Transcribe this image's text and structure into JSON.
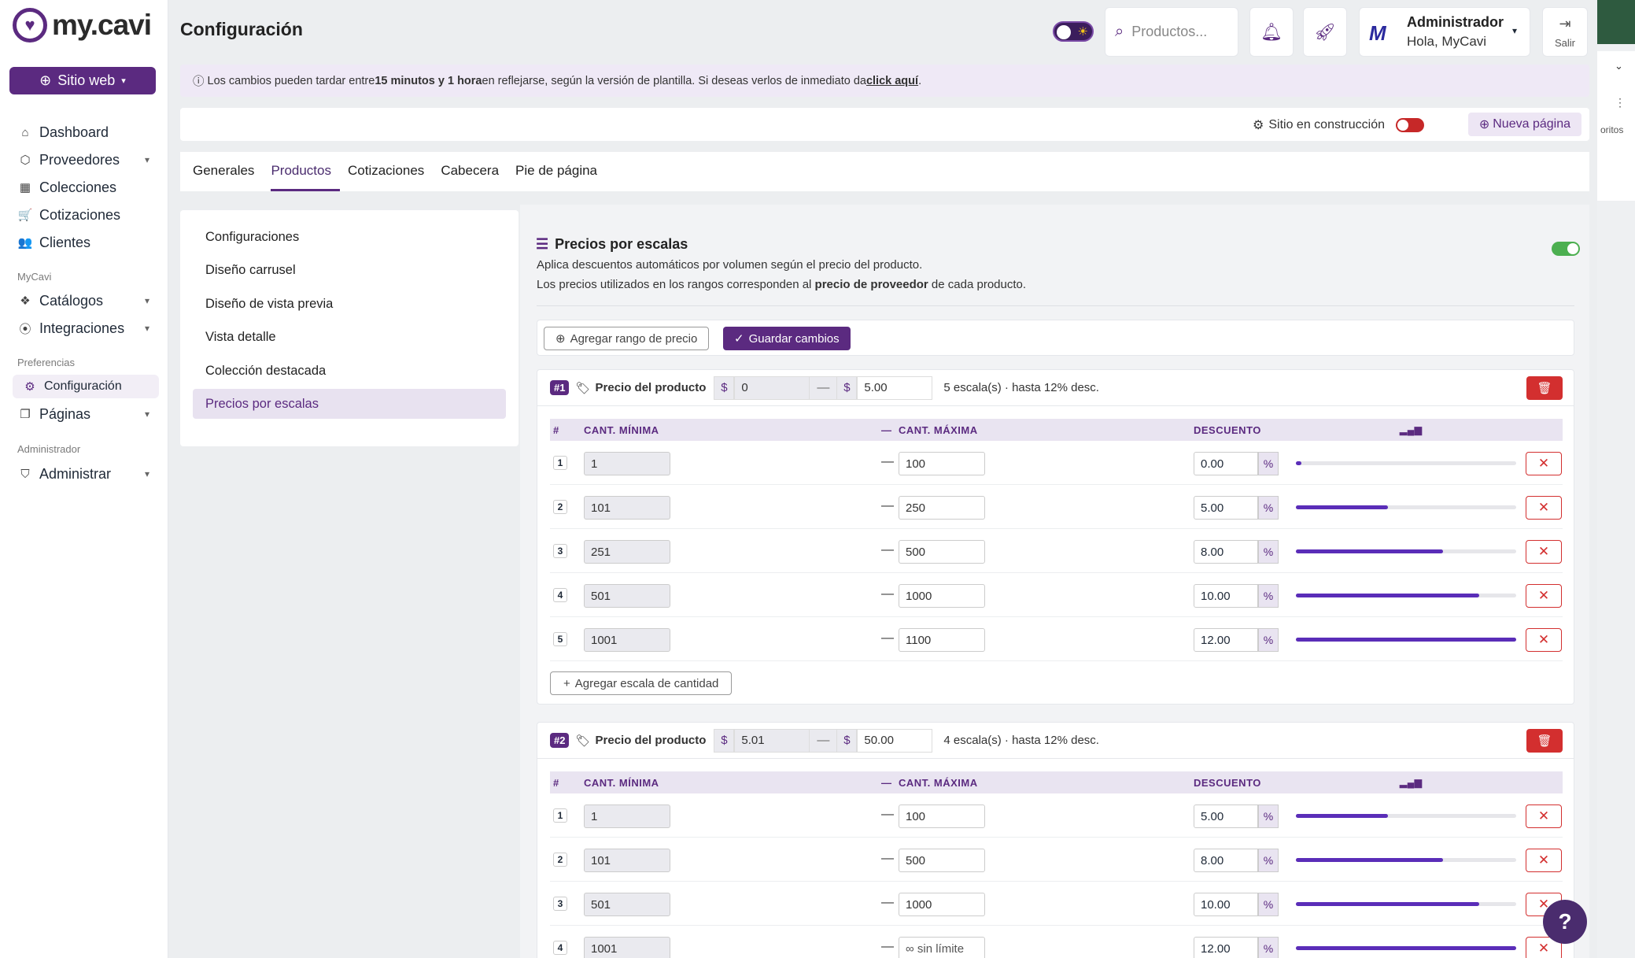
{
  "sidebar": {
    "logo": "my.cavi",
    "site_button": "Sitio web",
    "items": [
      {
        "label": "Dashboard",
        "icon": "home-icon"
      },
      {
        "label": "Proveedores",
        "icon": "box-icon"
      },
      {
        "label": "Colecciones",
        "icon": "grid-icon"
      },
      {
        "label": "Cotizaciones",
        "icon": "cart-icon"
      },
      {
        "label": "Clientes",
        "icon": "users-icon"
      }
    ],
    "sections": {
      "mycavi": "MyCavi",
      "prefs": "Preferencias",
      "admin": "Administrador"
    },
    "mycavi_items": [
      {
        "label": "Catálogos"
      },
      {
        "label": "Integraciones"
      }
    ],
    "prefs_items": [
      {
        "label": "Configuración"
      },
      {
        "label": "Páginas"
      }
    ],
    "admin_items": [
      {
        "label": "Administrar"
      }
    ]
  },
  "header": {
    "title": "Configuración",
    "search_placeholder": "Productos...",
    "user_name": "Administrador",
    "user_greeting": "Hola, MyCavi",
    "logout": "Salir"
  },
  "notice": {
    "pre": "Los cambios pueden tardar entre ",
    "bold": "15 minutos y 1 hora",
    "mid": " en reflejarse, según la versión de plantilla. Si deseas verlos de inmediato da ",
    "link": "click aquí",
    "post": "."
  },
  "toolbar": {
    "construction": "Sitio en construcción",
    "new_page": "Nueva página"
  },
  "tabs": [
    "Generales",
    "Productos",
    "Cotizaciones",
    "Cabecera",
    "Pie de página"
  ],
  "subnav": [
    "Configuraciones",
    "Diseño carrusel",
    "Diseño de vista previa",
    "Vista detalle",
    "Colección destacada",
    "Precios por escalas"
  ],
  "section": {
    "title": "Precios por escalas",
    "desc1": "Aplica descuentos automáticos por volumen según el precio del producto.",
    "desc2_pre": "Los precios utilizados en los rangos corresponden al ",
    "desc2_bold": "precio de proveedor",
    "desc2_post": " de cada producto.",
    "add_range": "Agregar rango de precio",
    "save": "Guardar cambios",
    "enabled": true
  },
  "table_headers": {
    "num": "#",
    "min": "CANT. MÍNIMA",
    "max": "CANT. MÁXIMA",
    "disc": "DESCUENTO",
    "dash": "—"
  },
  "add_scale": "Agregar escala de cantidad",
  "ranges": [
    {
      "badge": "#1",
      "label": "Precio del producto",
      "currency": "$",
      "from": "0",
      "to": "5.00",
      "summary": "5 escala(s) · hasta 12% desc.",
      "rows": [
        {
          "n": "1",
          "min": "1",
          "max": "100",
          "disc": "0.00",
          "pct": 0
        },
        {
          "n": "2",
          "min": "101",
          "max": "250",
          "disc": "5.00",
          "pct": 41.7
        },
        {
          "n": "3",
          "min": "251",
          "max": "500",
          "disc": "8.00",
          "pct": 66.7
        },
        {
          "n": "4",
          "min": "501",
          "max": "1000",
          "disc": "10.00",
          "pct": 83.3
        },
        {
          "n": "5",
          "min": "1001",
          "max": "1100",
          "disc": "12.00",
          "pct": 100
        }
      ]
    },
    {
      "badge": "#2",
      "label": "Precio del producto",
      "currency": "$",
      "from": "5.01",
      "to": "50.00",
      "summary": "4 escala(s) · hasta 12% desc.",
      "rows": [
        {
          "n": "1",
          "min": "1",
          "max": "100",
          "disc": "5.00",
          "pct": 41.7
        },
        {
          "n": "2",
          "min": "101",
          "max": "500",
          "disc": "8.00",
          "pct": 66.7
        },
        {
          "n": "3",
          "min": "501",
          "max": "1000",
          "disc": "10.00",
          "pct": 83.3
        },
        {
          "n": "4",
          "min": "1001",
          "max": "∞ sin límite",
          "disc": "12.00",
          "pct": 100
        }
      ]
    }
  ],
  "colors": {
    "brand": "#5b2a80",
    "danger": "#d32f2f",
    "bar": "#5a2db8"
  },
  "right_strip": {
    "partial_text": "oritos"
  }
}
